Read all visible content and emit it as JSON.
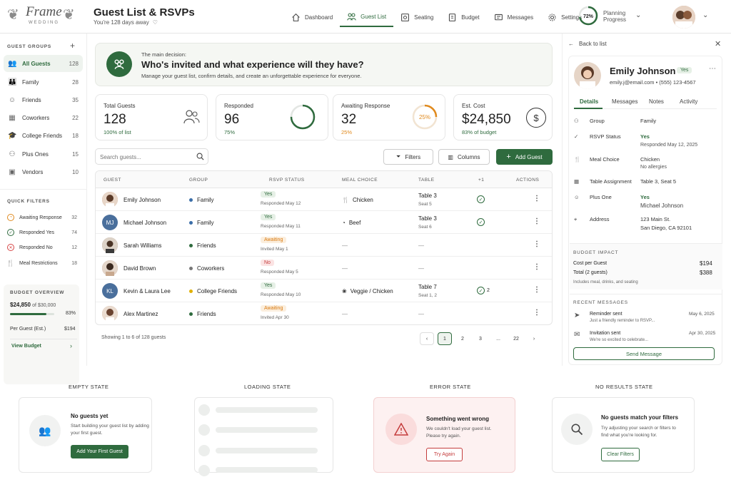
{
  "app": {
    "brand": "Frame",
    "brand_sub": "WEDDING",
    "title": "Guest List & RSVPs",
    "subtitle": "You're 128 days away"
  },
  "nav": [
    {
      "label": "Dashboard",
      "icon": "home-icon"
    },
    {
      "label": "Guest List",
      "icon": "guests-icon"
    },
    {
      "label": "Seating",
      "icon": "seating-icon"
    },
    {
      "label": "Budget",
      "icon": "budget-icon"
    },
    {
      "label": "Messages",
      "icon": "message-icon"
    },
    {
      "label": "Settings",
      "icon": "gear-icon"
    }
  ],
  "planning": {
    "percent": "72%",
    "percent_value": 72,
    "label1": "Planning",
    "label2": "Progress"
  },
  "sidebar": {
    "groups_title": "GUEST GROUPS",
    "groups": [
      {
        "label": "All Guests",
        "count": "128"
      },
      {
        "label": "Family",
        "count": "28"
      },
      {
        "label": "Friends",
        "count": "35"
      },
      {
        "label": "Coworkers",
        "count": "22"
      },
      {
        "label": "College Friends",
        "count": "18"
      },
      {
        "label": "Plus Ones",
        "count": "15"
      },
      {
        "label": "Vendors",
        "count": "10"
      }
    ],
    "filters_title": "QUICK FILTERS",
    "filters": [
      {
        "label": "Awaiting Response",
        "count": "32",
        "color": "#e08a1e"
      },
      {
        "label": "Responded Yes",
        "count": "74",
        "color": "#2f6b3e"
      },
      {
        "label": "Responded No",
        "count": "12",
        "color": "#d64545"
      },
      {
        "label": "Meal Restrictions",
        "count": "18",
        "color": "#666666"
      }
    ],
    "budget": {
      "title": "BUDGET OVERVIEW",
      "amount": "$24,850",
      "of": "of $30,000",
      "pct": "83%",
      "pct_value": 83,
      "per_guest_label": "Per Guest (Est.)",
      "per_guest": "$194",
      "link": "View Budget"
    }
  },
  "hero": {
    "kicker": "The main decision:",
    "heading": "Who's invited and what experience will they have?",
    "text": "Manage your guest list, confirm details, and create an unforgettable experience for everyone."
  },
  "stats": [
    {
      "label": "Total Guests",
      "value": "128",
      "sub": "100% of list"
    },
    {
      "label": "Responded",
      "value": "96",
      "sub": "75%",
      "ring": 75
    },
    {
      "label": "Awaiting Response",
      "value": "32",
      "sub": "25%",
      "ring": 25,
      "ring_label": "25%"
    },
    {
      "label": "Est. Cost",
      "value": "$24,850",
      "sub": "83% of budget"
    }
  ],
  "toolbar": {
    "search_placeholder": "Search guests...",
    "filters": "Filters",
    "columns": "Columns",
    "add": "Add Guest"
  },
  "table": {
    "headers": [
      "GUEST",
      "GROUP",
      "RSVP STATUS",
      "MEAL CHOICE",
      "TABLE",
      "+1",
      "ACTIONS"
    ],
    "rows": [
      {
        "name": "Emily Johnson",
        "initials": "",
        "group": "Family",
        "group_color": "#3b6ea8",
        "status": "Yes",
        "status_sub": "Responded May 12",
        "meal": "Chicken",
        "table": "Table 3",
        "seat": "Seat 5",
        "plus": true,
        "plus_count": ""
      },
      {
        "name": "Michael Johnson",
        "initials": "MJ",
        "group": "Family",
        "group_color": "#3b6ea8",
        "status": "Yes",
        "status_sub": "Responded May 11",
        "meal": "Beef",
        "table": "Table 3",
        "seat": "Seat 6",
        "plus": true,
        "plus_count": ""
      },
      {
        "name": "Sarah Williams",
        "initials": "",
        "group": "Friends",
        "group_color": "#2f6b3e",
        "status": "Awaiting",
        "status_sub": "Invited May 1",
        "meal": "—",
        "table": "—",
        "seat": "",
        "plus": false,
        "plus_count": ""
      },
      {
        "name": "David Brown",
        "initials": "",
        "group": "Coworkers",
        "group_color": "#777777",
        "status": "No",
        "status_sub": "Responded May 5",
        "meal": "—",
        "table": "—",
        "seat": "",
        "plus": false,
        "plus_count": ""
      },
      {
        "name": "Kevin & Laura Lee",
        "initials": "KL",
        "group": "College Friends",
        "group_color": "#e0b000",
        "status": "Yes",
        "status_sub": "Responded May 10",
        "meal": "Veggie / Chicken",
        "table": "Table 7",
        "seat": "Seat 1, 2",
        "plus": true,
        "plus_count": "2"
      },
      {
        "name": "Alex Martinez",
        "initials": "",
        "group": "Friends",
        "group_color": "#2f6b3e",
        "status": "Awaiting",
        "status_sub": "Invited Apr 30",
        "meal": "—",
        "table": "—",
        "seat": "",
        "plus": false,
        "plus_count": ""
      }
    ],
    "footer": "Showing 1 to 6 of 128 guests",
    "pages": [
      "1",
      "2",
      "3",
      "...",
      "22"
    ]
  },
  "panel": {
    "back": "Back to list",
    "name": "Emily Johnson",
    "badge": "Yes",
    "contact": "emily.j@email.com • (555) 123-4567",
    "tabs": [
      "Details",
      "Messages",
      "Notes",
      "Activity"
    ],
    "details": [
      {
        "label": "Group",
        "value": "Family",
        "sub": ""
      },
      {
        "label": "RSVP Status",
        "value": "Yes",
        "sub": "Responded May 12, 2025"
      },
      {
        "label": "Meal Choice",
        "value": "Chicken",
        "sub": "No allergies"
      },
      {
        "label": "Table Assignment",
        "value": "Table 3, Seat 5",
        "sub": ""
      },
      {
        "label": "Plus One",
        "value": "Yes",
        "sub": "Michael Johnson"
      },
      {
        "label": "Address",
        "value": "123 Main St.",
        "sub": "San Diego, CA 92101"
      }
    ],
    "budget": {
      "title": "BUDGET IMPACT",
      "cost_label": "Cost per Guest",
      "cost": "$194",
      "total_label": "Total (2 guests)",
      "total": "$388",
      "note": "Includes meal, drinks, and seating"
    },
    "messages": {
      "title": "RECENT MESSAGES",
      "items": [
        {
          "title": "Reminder sent",
          "text": "Just a friendly reminder to RSVP...",
          "date": "May 6, 2025"
        },
        {
          "title": "Invitation sent",
          "text": "We're so excited to celebrate...",
          "date": "Apr 30, 2025"
        }
      ],
      "button": "Send Message"
    }
  },
  "states": {
    "empty": {
      "heading": "EMPTY STATE",
      "title": "No guests yet",
      "text1": "Start building your guest list by adding",
      "text2": "your first guest.",
      "button": "Add Your First Guest"
    },
    "loading": {
      "heading": "LOADING STATE"
    },
    "error": {
      "heading": "ERROR STATE",
      "title": "Something went wrong",
      "text1": "We couldn't load your guest list.",
      "text2": "Please try again.",
      "button": "Try Again"
    },
    "noresults": {
      "heading": "NO RESULTS STATE",
      "title": "No guests match your filters",
      "text1": "Try adjusting your search or filters to",
      "text2": "find what you're looking for.",
      "button": "Clear Filters"
    }
  }
}
